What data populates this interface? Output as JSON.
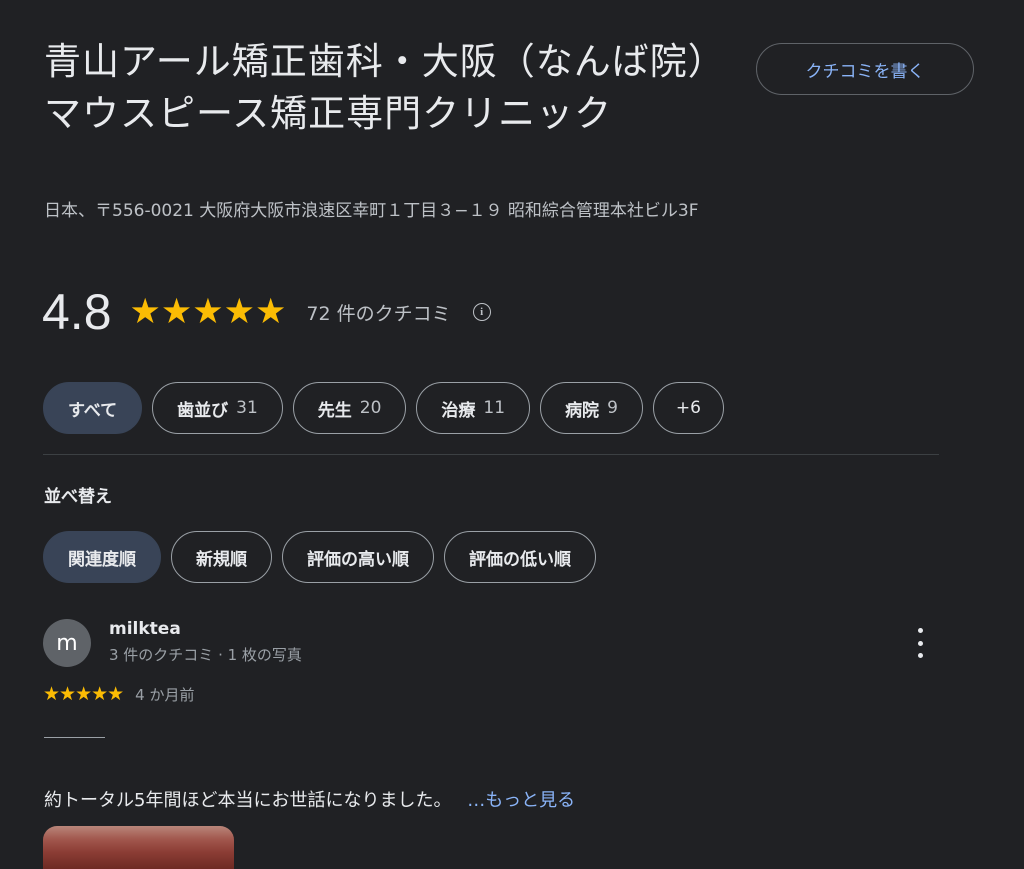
{
  "place": {
    "title": "青山アール矯正歯科・大阪（なんば院）マウスピース矯正専門クリニック",
    "address": "日本、〒556-0021 大阪府大阪市浪速区幸町１丁目３−１９ 昭和綜合管理本社ビル3F",
    "write_review_label": "クチコミを書く"
  },
  "rating": {
    "value": "4.8",
    "stars": "★★★★★",
    "stars_value": 4.8,
    "review_count_label": "72 件のクチコミ",
    "info_icon": "info-icon",
    "star_color": "#fbbc04"
  },
  "topic_chips": [
    {
      "label": "すべて",
      "count": ""
    },
    {
      "label": "歯並び",
      "count": "31"
    },
    {
      "label": "先生",
      "count": "20"
    },
    {
      "label": "治療",
      "count": "11"
    },
    {
      "label": "病院",
      "count": "9"
    },
    {
      "label": "+6",
      "count": ""
    }
  ],
  "sort": {
    "label": "並べ替え",
    "options": [
      "関連度順",
      "新規順",
      "評価の高い順",
      "評価の低い順"
    ]
  },
  "review": {
    "avatar_letter": "m",
    "user_name": "milktea",
    "user_meta": "3 件のクチコミ · 1 枚の写真",
    "stars": "★★★★★",
    "stars_value": 5,
    "date": "4 か月前",
    "text": "約トータル5年間ほど本当にお世話になりました。",
    "more_label": "…もっと見る",
    "menu_icon": "more-vert-icon"
  },
  "colors": {
    "background": "#202124",
    "accent_link": "#8ab4f8",
    "active_chip": "#394457"
  }
}
